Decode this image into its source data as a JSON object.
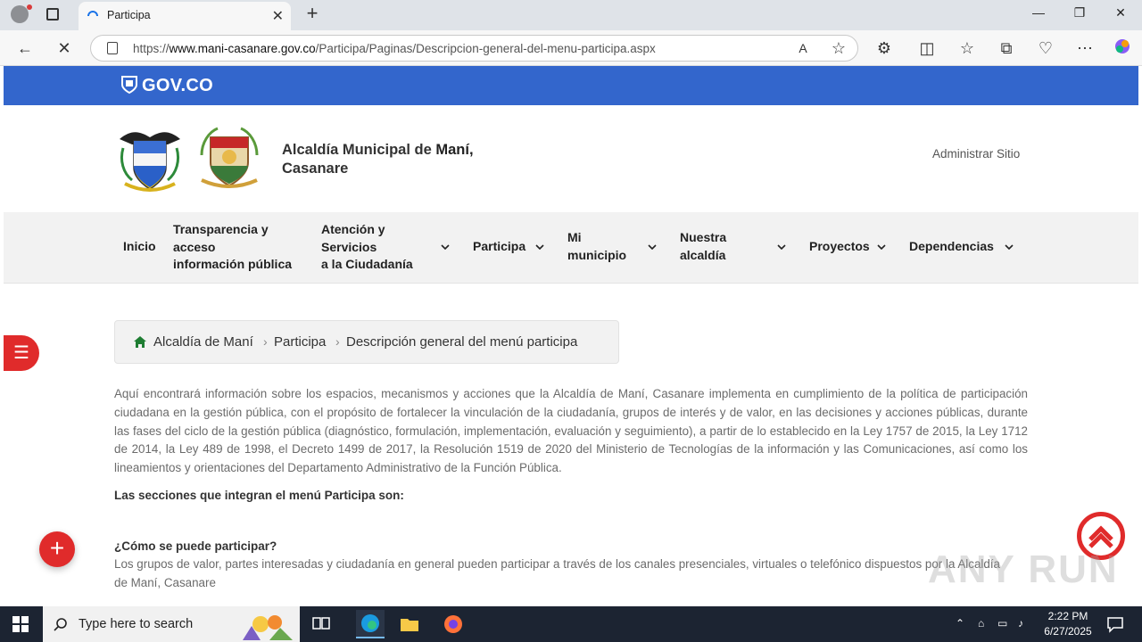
{
  "browser": {
    "tab_title": "Participa",
    "url_prefix": "https://",
    "url_domain": "www.mani-casanare.gov.co",
    "url_path": "/Participa/Paginas/Descripcion-general-del-menu-participa.aspx"
  },
  "gov": {
    "brand": "GOV.CO"
  },
  "header": {
    "title_prefix": "Alcaldía Municipal de ",
    "title_bold": "Maní,",
    "title_line2": "Casanare",
    "admin": "Administrar Sitio"
  },
  "nav": {
    "items": [
      {
        "label1": "Inicio",
        "label2": "",
        "label3": ""
      },
      {
        "label1": "Transparencia y",
        "label2": "acceso",
        "label3": "información pública"
      },
      {
        "label1": "Atención y",
        "label2": "Servicios",
        "label3": "a la Ciudadanía"
      },
      {
        "label1": "Participa",
        "label2": "",
        "label3": ""
      },
      {
        "label1": "Mi",
        "label2": "municipio",
        "label3": ""
      },
      {
        "label1": "Nuestra",
        "label2": "alcaldía",
        "label3": ""
      },
      {
        "label1": "Proyectos",
        "label2": "",
        "label3": ""
      },
      {
        "label1": "Dependencias",
        "label2": "",
        "label3": ""
      }
    ]
  },
  "breadcrumb": {
    "home": "Alcaldía de Maní",
    "level1": "Participa",
    "current": "Descripción general del menú participa"
  },
  "content": {
    "intro": "Aquí encontrará información sobre los espacios, mecanismos y acciones que la Alcaldía de Maní, Casanare implementa en cumplimiento de la política de participación ciudadana en la gestión pública, con el propósito de fortalecer la vinculación de la ciudadanía, grupos de interés y de valor, en las decisiones y acciones públicas, durante las fases del ciclo de la gestión pública (diagnóstico, formulación, implementación, evaluación y seguimiento), a partir de lo establecido en la Ley 1757 de 2015, la Ley 1712 de 2014, la Ley 489 de 1998, el Decreto 1499 de 2017, la Resolución 1519 de 2020 del Ministerio de Tecnologías de la información y las Comunicaciones, así como los lineamientos y orientaciones del Departamento Administrativo de la Función Pública.",
    "sections_title": "Las secciones que integran el menú Participa son:",
    "q_title": "¿Cómo se puede participar?",
    "q_text": "Los grupos de valor, partes interesadas y ciudadanía en general pueden participar a través de los canales presenciales, virtuales o telefónico dispuestos por la Alcaldía de Maní, Casanare"
  },
  "watermark": "ANY RUN",
  "taskbar": {
    "search_placeholder": "Type here to search",
    "time": "2:22 PM",
    "date": "6/27/2025"
  },
  "colors": {
    "gov_blue": "#3366cc",
    "accent_red": "#e02b2b",
    "taskbar": "#1c2432"
  }
}
